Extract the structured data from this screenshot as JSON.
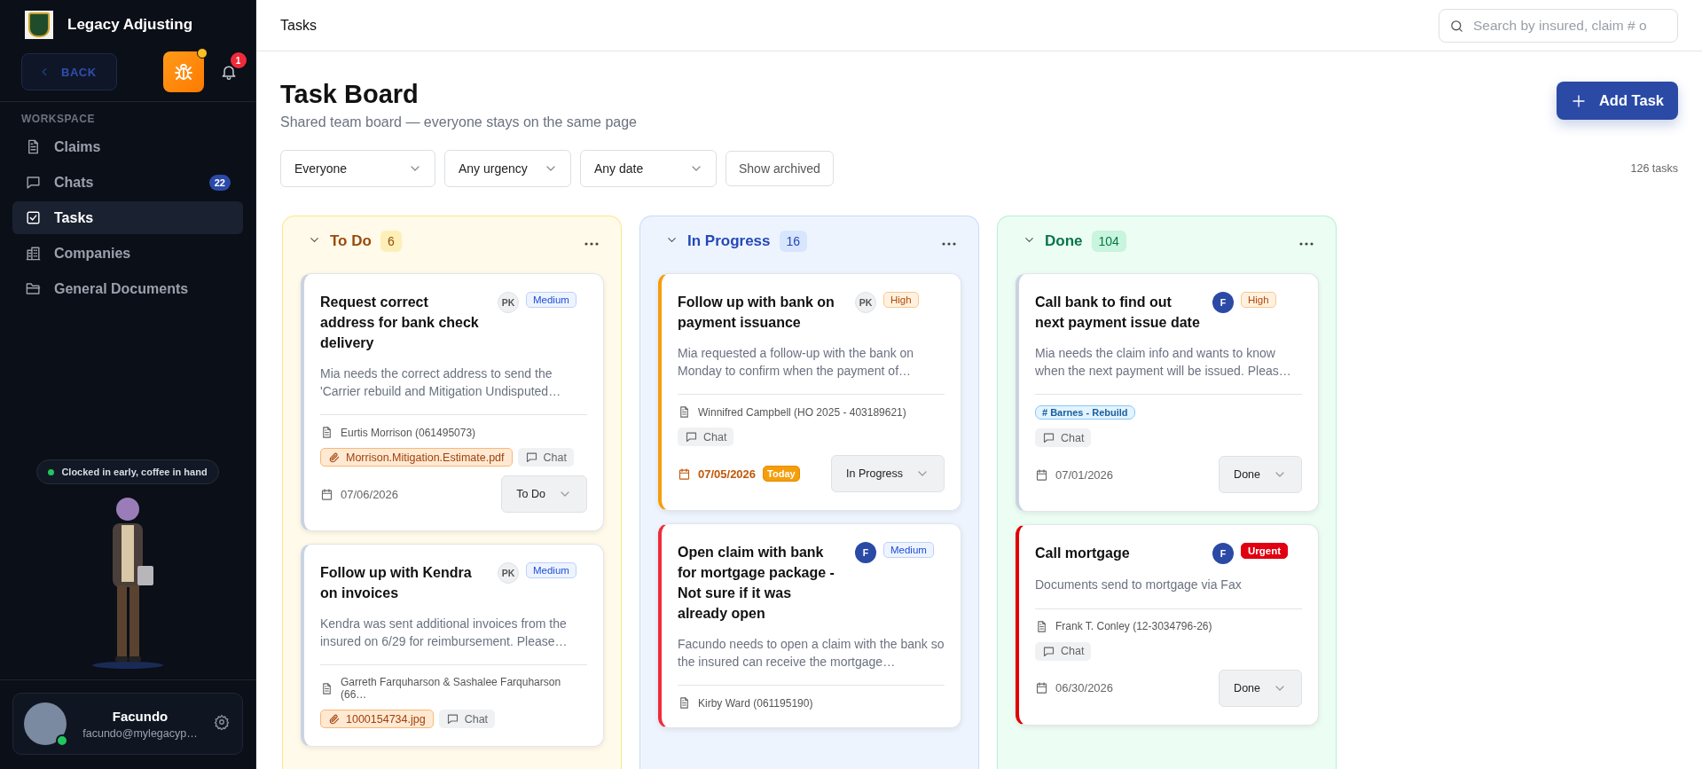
{
  "sidebar": {
    "brand": "Legacy Adjusting",
    "back_button": "BACK",
    "notification_count": "1",
    "section_label": "WORKSPACE",
    "items": [
      {
        "label": "Claims",
        "selected": false
      },
      {
        "label": "Chats",
        "selected": false,
        "badge": "22"
      },
      {
        "label": "Tasks",
        "selected": true
      },
      {
        "label": "Companies",
        "selected": false
      },
      {
        "label": "General Documents",
        "selected": false
      }
    ],
    "status": "Clocked in early, coffee in hand",
    "user": {
      "name": "Facundo",
      "email": "facundo@mylegacyp…"
    }
  },
  "header": {
    "breadcrumb": "Tasks",
    "search_placeholder": "Search by insured, claim # o"
  },
  "board": {
    "title": "Task Board",
    "subtitle": "Shared team board — everyone stays on the same page",
    "add_button": "Add Task",
    "filters": [
      {
        "label": "Everyone"
      },
      {
        "label": "Any urgency"
      },
      {
        "label": "Any date"
      }
    ],
    "archived_button": "Show archived",
    "task_count": "126 tasks"
  },
  "columns": [
    {
      "kind": "todo",
      "title": "To Do",
      "count": "6",
      "cards": [
        {
          "title": "Request correct address for bank check delivery",
          "color": "#c9d3e3",
          "assignee": {
            "initials": "PK",
            "kind": "initials"
          },
          "priority": {
            "label": "Medium",
            "kind": "medium"
          },
          "description": "Mia needs the correct address to send the 'Carrier rebuild and Mitigation Undisputed…",
          "claim": "Eurtis Morrison (061495073)",
          "attachment": "Morrison.Mitigation.Estimate.pdf",
          "chat": "Chat",
          "date": "07/06/2026",
          "due_today": false,
          "status": "To Do"
        },
        {
          "title": "Follow up with Kendra on invoices",
          "color": "#c9d3e3",
          "assignee": {
            "initials": "PK",
            "kind": "initials"
          },
          "priority": {
            "label": "Medium",
            "kind": "medium"
          },
          "description": "Kendra was sent additional invoices from the insured on 6/29 for reimbursement. Please…",
          "claim": "Garreth Farquharson & Sashalee Farquharson (66…",
          "attachment": "1000154734.jpg",
          "chat": "Chat"
        }
      ]
    },
    {
      "kind": "progress",
      "title": "In Progress",
      "count": "16",
      "cards": [
        {
          "title": "Follow up with bank on payment issuance",
          "color": "#f59e0b",
          "assignee": {
            "initials": "PK",
            "kind": "initials"
          },
          "priority": {
            "label": "High",
            "kind": "high"
          },
          "description": "Mia requested a follow-up with the bank on Monday to confirm when the payment of…",
          "claim": "Winnifred Campbell (HO 2025 - 403189621)",
          "chat": "Chat",
          "date": "07/05/2026",
          "due_today": true,
          "date_badge": "Today",
          "status": "In Progress"
        },
        {
          "title": "Open claim with bank for mortgage package - Not sure if it was already open",
          "color": "#ef2b3b",
          "assignee": {
            "initials": "F",
            "kind": "filled"
          },
          "priority": {
            "label": "Medium",
            "kind": "medium"
          },
          "description": "Facundo needs to open a claim with the bank so the insured can receive the mortgage…",
          "claim": "Kirby Ward (061195190)"
        }
      ]
    },
    {
      "kind": "done",
      "title": "Done",
      "count": "104",
      "cards": [
        {
          "title": "Call bank to find out next payment issue date",
          "color": "#c9d3e3",
          "assignee": {
            "initials": "F",
            "kind": "filled"
          },
          "priority": {
            "label": "High",
            "kind": "high"
          },
          "description": "Mia needs the claim info and wants to know when the next payment will be issued. Pleas…",
          "tag": "# Barnes - Rebuild",
          "chat": "Chat",
          "date": "07/01/2026",
          "due_today": false,
          "status": "Done"
        },
        {
          "title": "Call mortgage",
          "color": "#e00000",
          "assignee": {
            "initials": "F",
            "kind": "filled"
          },
          "priority": {
            "label": "Urgent",
            "kind": "urgent"
          },
          "description": "Documents send to mortgage via Fax",
          "claim": "Frank T. Conley (12-3034796-26)",
          "chat": "Chat",
          "date": "06/30/2026",
          "due_today": false,
          "status": "Done"
        }
      ]
    }
  ]
}
